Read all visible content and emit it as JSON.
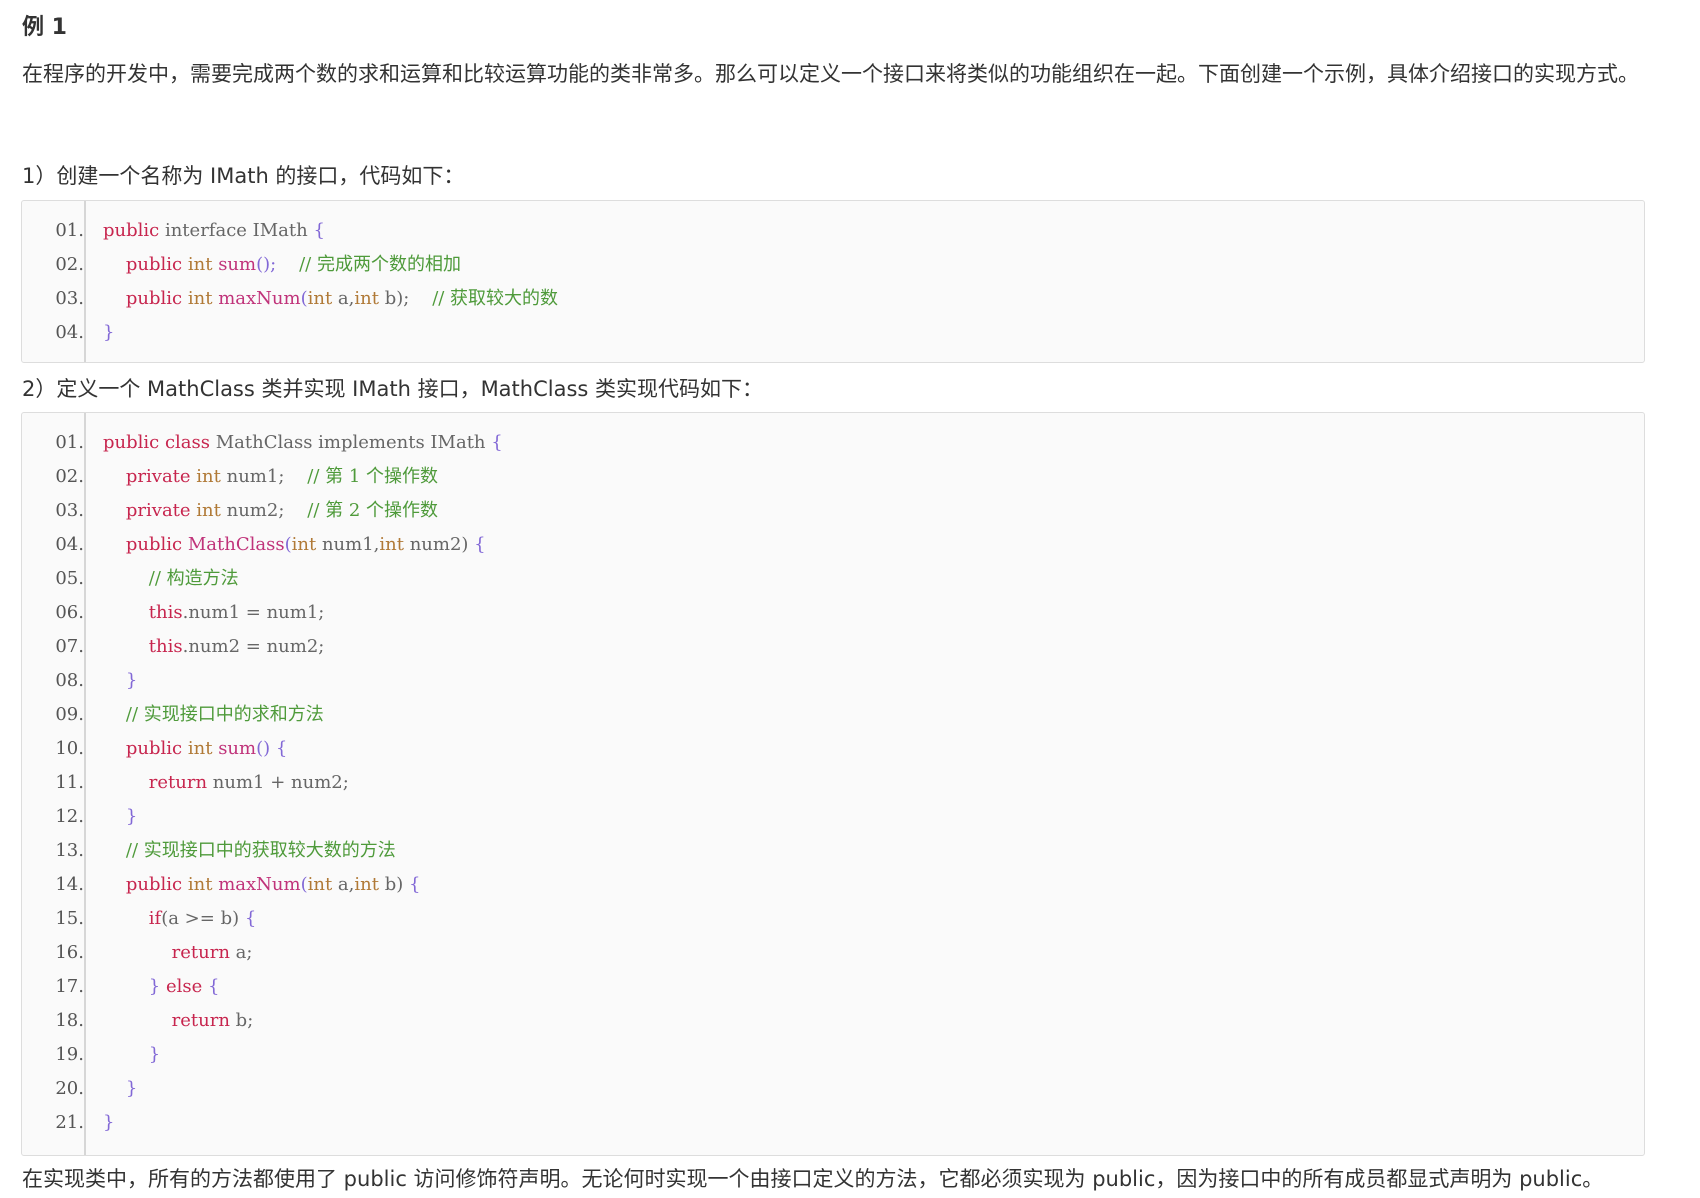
{
  "heading": "例 1",
  "intro": "在程序的开发中，需要完成两个数的求和运算和比较运算功能的类非常多。那么可以定义一个接口来将类似的功能组织在一起。下面创建一个示例，具体介绍接口的实现方式。",
  "step1": "1）创建一个名称为 IMath 的接口，代码如下：",
  "step2": "2）定义一个 MathClass 类并实现 IMath 接口，MathClass 类实现代码如下：",
  "final": "在实现类中，所有的方法都使用了 public 访问修饰符声明。无论何时实现一个由接口定义的方法，它都必须实现为 public，因为接口中的所有成员都显式声明为 public。",
  "code_blocks": [
    {
      "lines": [
        {
          "num": "01.",
          "indent": 0,
          "tokens": [
            [
              "k",
              "public"
            ],
            [
              "i",
              " interface IMath "
            ],
            [
              "pn",
              "{"
            ]
          ]
        },
        {
          "num": "02.",
          "indent": 1,
          "tokens": [
            [
              "k",
              "public"
            ],
            [
              "i",
              " "
            ],
            [
              "t",
              "int"
            ],
            [
              "i",
              " "
            ],
            [
              "f",
              "sum"
            ],
            [
              "pn",
              "();"
            ],
            [
              "i",
              "    "
            ],
            [
              "c",
              "// 完成两个数的相加"
            ]
          ]
        },
        {
          "num": "03.",
          "indent": 1,
          "tokens": [
            [
              "k",
              "public"
            ],
            [
              "i",
              " "
            ],
            [
              "t",
              "int"
            ],
            [
              "i",
              " "
            ],
            [
              "f",
              "maxNum"
            ],
            [
              "pn",
              "("
            ],
            [
              "t",
              "int"
            ],
            [
              "i",
              " a,"
            ],
            [
              "t",
              "int"
            ],
            [
              "i",
              " b);"
            ],
            [
              "i",
              "    "
            ],
            [
              "c",
              "// 获取较大的数"
            ]
          ]
        },
        {
          "num": "04.",
          "indent": 0,
          "tokens": [
            [
              "pn",
              "}"
            ]
          ]
        }
      ]
    },
    {
      "lines": [
        {
          "num": "01.",
          "indent": 0,
          "tokens": [
            [
              "k",
              "public class"
            ],
            [
              "i",
              " MathClass implements IMath "
            ],
            [
              "pn",
              "{"
            ]
          ]
        },
        {
          "num": "02.",
          "indent": 1,
          "tokens": [
            [
              "k",
              "private"
            ],
            [
              "i",
              " "
            ],
            [
              "t",
              "int"
            ],
            [
              "i",
              " num1;    "
            ],
            [
              "c",
              "// 第 1 个操作数"
            ]
          ]
        },
        {
          "num": "03.",
          "indent": 1,
          "tokens": [
            [
              "k",
              "private"
            ],
            [
              "i",
              " "
            ],
            [
              "t",
              "int"
            ],
            [
              "i",
              " num2;    "
            ],
            [
              "c",
              "// 第 2 个操作数"
            ]
          ]
        },
        {
          "num": "04.",
          "indent": 1,
          "tokens": [
            [
              "k",
              "public"
            ],
            [
              "i",
              " "
            ],
            [
              "f",
              "MathClass"
            ],
            [
              "pn",
              "("
            ],
            [
              "t",
              "int"
            ],
            [
              "i",
              " num1,"
            ],
            [
              "t",
              "int"
            ],
            [
              "i",
              " num2) "
            ],
            [
              "pn",
              "{"
            ]
          ]
        },
        {
          "num": "05.",
          "indent": 2,
          "tokens": [
            [
              "c",
              "// 构造方法"
            ]
          ]
        },
        {
          "num": "06.",
          "indent": 2,
          "tokens": [
            [
              "k",
              "this"
            ],
            [
              "i",
              ".num1 = num1;"
            ]
          ]
        },
        {
          "num": "07.",
          "indent": 2,
          "tokens": [
            [
              "k",
              "this"
            ],
            [
              "i",
              ".num2 = num2;"
            ]
          ]
        },
        {
          "num": "08.",
          "indent": 1,
          "tokens": [
            [
              "pn",
              "}"
            ]
          ]
        },
        {
          "num": "09.",
          "indent": 1,
          "tokens": [
            [
              "c",
              "// 实现接口中的求和方法"
            ]
          ]
        },
        {
          "num": "10.",
          "indent": 1,
          "tokens": [
            [
              "k",
              "public"
            ],
            [
              "i",
              " "
            ],
            [
              "t",
              "int"
            ],
            [
              "i",
              " "
            ],
            [
              "f",
              "sum"
            ],
            [
              "pn",
              "() {"
            ]
          ]
        },
        {
          "num": "11.",
          "indent": 2,
          "tokens": [
            [
              "k",
              "return"
            ],
            [
              "i",
              " num1 + num2;"
            ]
          ]
        },
        {
          "num": "12.",
          "indent": 1,
          "tokens": [
            [
              "pn",
              "}"
            ]
          ]
        },
        {
          "num": "13.",
          "indent": 1,
          "tokens": [
            [
              "c",
              "// 实现接口中的获取较大数的方法"
            ]
          ]
        },
        {
          "num": "14.",
          "indent": 1,
          "tokens": [
            [
              "k",
              "public"
            ],
            [
              "i",
              " "
            ],
            [
              "t",
              "int"
            ],
            [
              "i",
              " "
            ],
            [
              "f",
              "maxNum"
            ],
            [
              "pn",
              "("
            ],
            [
              "t",
              "int"
            ],
            [
              "i",
              " a,"
            ],
            [
              "t",
              "int"
            ],
            [
              "i",
              " b) "
            ],
            [
              "pn",
              "{"
            ]
          ]
        },
        {
          "num": "15.",
          "indent": 2,
          "tokens": [
            [
              "k",
              "if"
            ],
            [
              "i",
              "(a >= b) "
            ],
            [
              "pn",
              "{"
            ]
          ]
        },
        {
          "num": "16.",
          "indent": 3,
          "tokens": [
            [
              "k",
              "return"
            ],
            [
              "i",
              " a;"
            ]
          ]
        },
        {
          "num": "17.",
          "indent": 2,
          "tokens": [
            [
              "pn",
              "}"
            ],
            [
              "i",
              " "
            ],
            [
              "k",
              "else"
            ],
            [
              "i",
              " "
            ],
            [
              "pn",
              "{"
            ]
          ]
        },
        {
          "num": "18.",
          "indent": 3,
          "tokens": [
            [
              "k",
              "return"
            ],
            [
              "i",
              " b;"
            ]
          ]
        },
        {
          "num": "19.",
          "indent": 2,
          "tokens": [
            [
              "pn",
              "}"
            ]
          ]
        },
        {
          "num": "20.",
          "indent": 1,
          "tokens": [
            [
              "pn",
              "}"
            ]
          ]
        },
        {
          "num": "21.",
          "indent": 0,
          "tokens": [
            [
              "pn",
              "}"
            ]
          ]
        }
      ]
    }
  ]
}
